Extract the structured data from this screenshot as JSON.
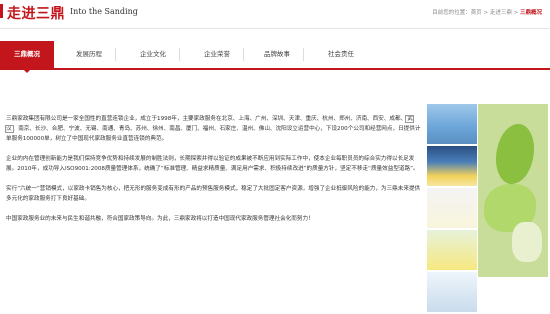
{
  "header": {
    "title": "走进三鼎",
    "subtitle": "Into the Sanding",
    "breadcrumb_prefix": "目前您的位置：首页 > 走进三鼎 > ",
    "breadcrumb_current": "三鼎概况"
  },
  "tabs": [
    {
      "label": "三鼎概况",
      "active": true
    },
    {
      "label": "发展历程",
      "active": false
    },
    {
      "label": "企业文化",
      "active": false
    },
    {
      "label": "企业荣誉",
      "active": false
    },
    {
      "label": "品牌故事",
      "active": false
    },
    {
      "label": "社会责任",
      "active": false
    }
  ],
  "content": {
    "p1_before": "三鼎家政集团有限公司是一家全国性的直营连锁企业，成立于1998年，主要家政服务在北京、上海、广州、深圳、天津、重庆、杭州、郑州、济南、西安、成都、",
    "p1_highlight": "武汉",
    "p1_after": "、南京、长沙、合肥、宁波、无锡、南通、青岛、苏州、徐州、南昌、厦门、福州、石家庄、温州、佛山、沈阳设立运营中心，下设200个公司和经营网点，日提供计单服务100000单，树立了中国现代家政服务业直营连锁的典范。",
    "p2": "企业的内在管理创新能力是我们保持竞争优势和持续发展的制胜法则，长期探索并得以验证的成果被不断应用到实际工作中，使本企业每职员员的综合实力得以长足发展。2010年，成功导入ISO9001:2008质量管理体系，统确了“标准管理、精益求精质量、满足用户需求、积极持续改进”的质量方针，坚定不移走“质量效益型道路”。",
    "p3": "实行“六统一”营销模式，以家政卡销售为核心，把无形的服务变成有形的产品的预售服务模式，稳定了大批固定客户资源，增强了企业抵御风险的能力，为三鼎未来提供多元化的家政服务打下良好基础。",
    "p4": "中国家政服务业的未来与民生和谐共融，符合国家政策导向。为此，三鼎家政将以打造中国现代家政服务管理社会化而努力！"
  }
}
